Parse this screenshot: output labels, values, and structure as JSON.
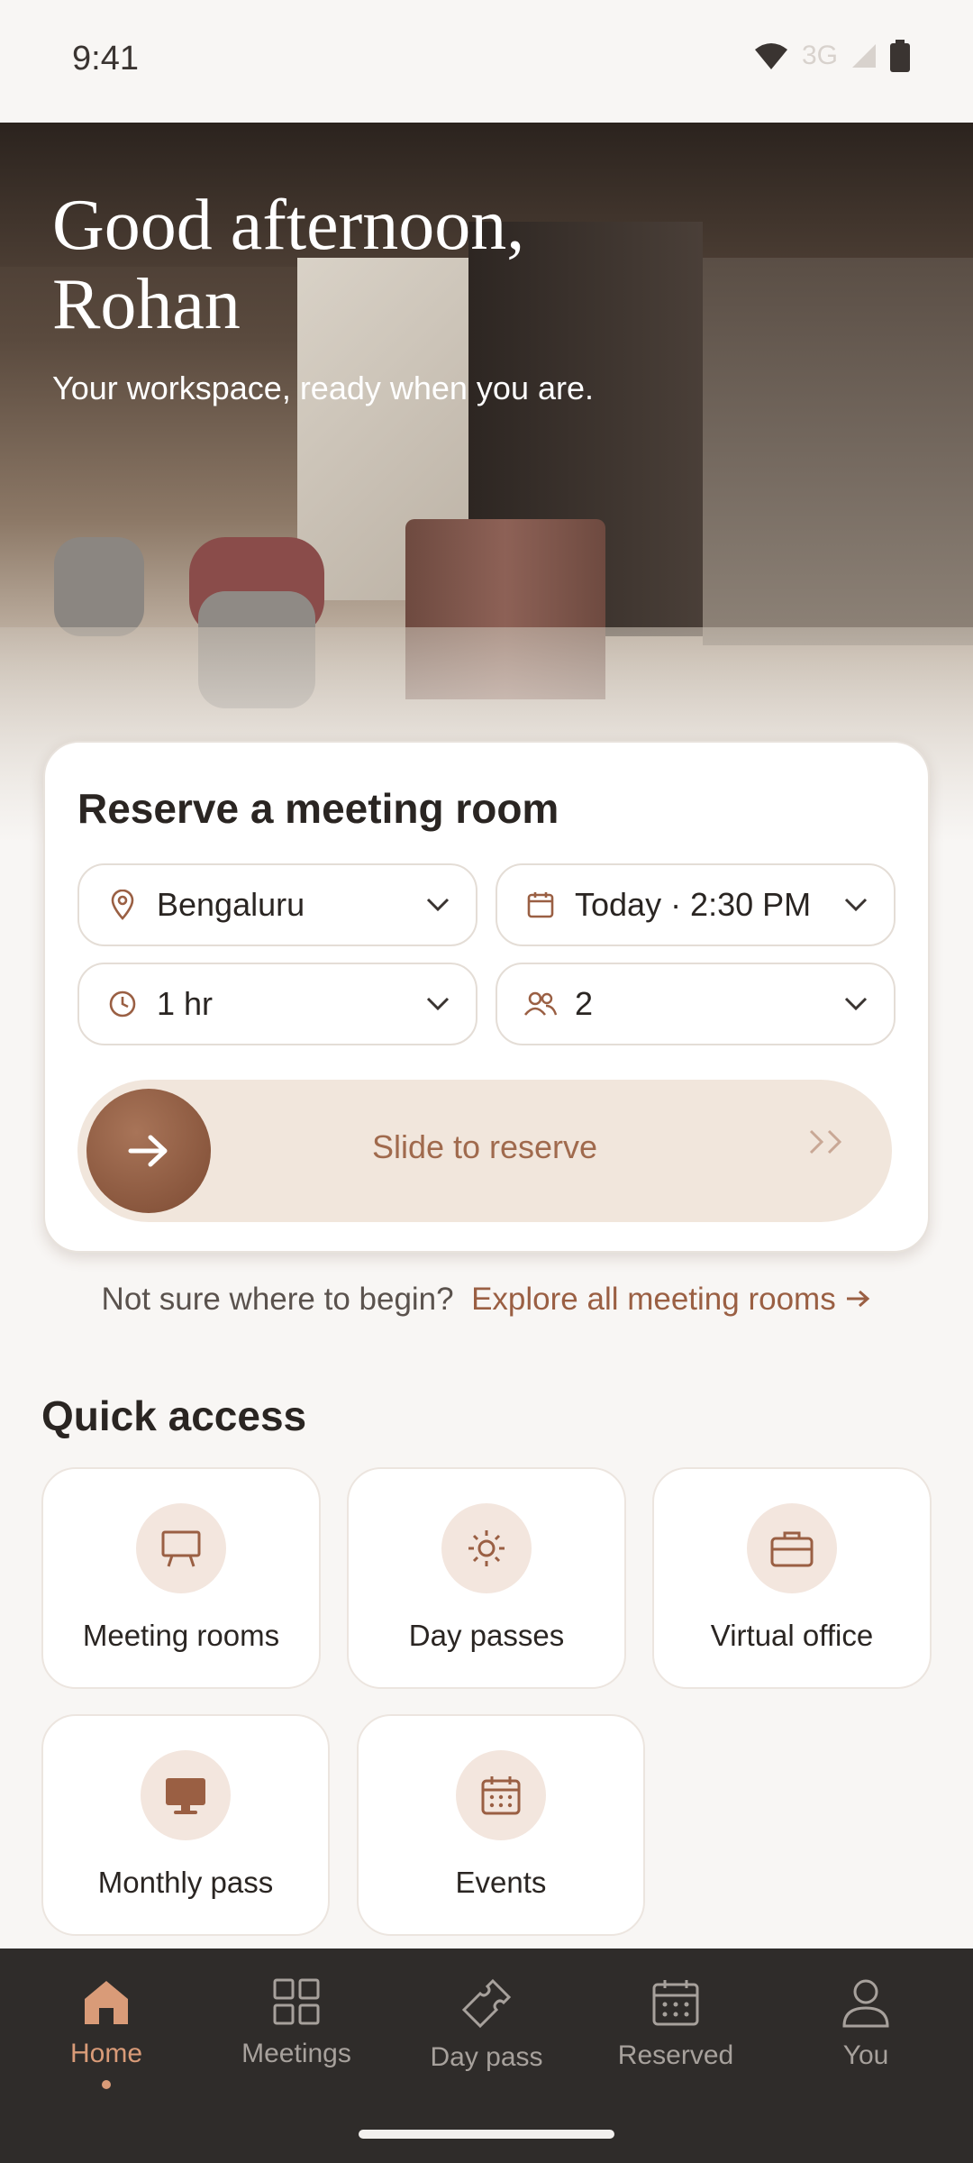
{
  "status": {
    "time": "9:41"
  },
  "hero": {
    "greeting_line1": "Good afternoon,",
    "greeting_line2": "Rohan",
    "subtitle": "Your workspace, ready when you are."
  },
  "reserve": {
    "title": "Reserve a meeting room",
    "location": "Bengaluru",
    "datetime": "Today · 2:30 PM",
    "duration": "1 hr",
    "guests": "2",
    "slide_label": "Slide to reserve"
  },
  "explore": {
    "prompt": "Not sure where to begin?",
    "link": "Explore all meeting rooms"
  },
  "quick_access": {
    "title": "Quick access",
    "items": [
      {
        "label": "Meeting rooms",
        "icon": "presentation-board-icon"
      },
      {
        "label": "Day passes",
        "icon": "sun-icon"
      },
      {
        "label": "Virtual office",
        "icon": "briefcase-icon"
      },
      {
        "label": "Monthly pass",
        "icon": "monitor-icon"
      },
      {
        "label": "Events",
        "icon": "calendar-grid-icon"
      }
    ]
  },
  "nav": {
    "items": [
      {
        "label": "Home",
        "icon": "home-icon"
      },
      {
        "label": "Meetings",
        "icon": "grid-icon"
      },
      {
        "label": "Day pass",
        "icon": "ticket-icon"
      },
      {
        "label": "Reserved",
        "icon": "calendar-icon"
      },
      {
        "label": "You",
        "icon": "user-icon"
      }
    ],
    "active": "Home"
  },
  "colors": {
    "accent": "#9a5f43",
    "nav_bg": "#2f2c2a",
    "nav_active": "#d99b78"
  }
}
